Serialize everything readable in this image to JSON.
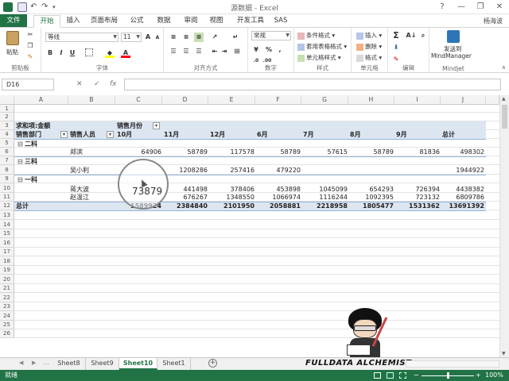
{
  "window": {
    "title": "源数据 - Excel",
    "user": "杨海波",
    "help": "?",
    "minimize": "—",
    "restore": "❐",
    "close": "✕"
  },
  "tabs": [
    "文件",
    "开始",
    "插入",
    "页面布局",
    "公式",
    "数据",
    "审阅",
    "视图",
    "开发工具",
    "SAS"
  ],
  "ribbon": {
    "clipboard": {
      "label": "剪贴板",
      "paste": "粘贴"
    },
    "font": {
      "label": "字体",
      "name": "等线",
      "size": "11",
      "bold": "B",
      "italic": "I",
      "underline": "U",
      "grow": "A",
      "shrink": "A",
      "color": "A"
    },
    "alignment": {
      "label": "对齐方式"
    },
    "number": {
      "label": "数字",
      "format": "常规",
      "percent": "%",
      "comma": ","
    },
    "styles": {
      "label": "样式",
      "conditional": "条件格式",
      "table": "套用表格格式",
      "cell": "单元格样式"
    },
    "cells": {
      "label": "单元格",
      "insert": "插入",
      "delete": "删除",
      "format": "格式"
    },
    "editing": {
      "label": "编辑",
      "sum": "Σ"
    },
    "mindjet": {
      "label": "Mindjet",
      "send": "发送到",
      "app": "MindManager"
    }
  },
  "formula_bar": {
    "name_box": "D16",
    "cancel": "✕",
    "confirm": "✓",
    "fx": "fx",
    "value": ""
  },
  "columns": [
    "A",
    "B",
    "C",
    "D",
    "E",
    "F",
    "G",
    "H",
    "I",
    "J"
  ],
  "rows": [
    "1",
    "2",
    "3",
    "4",
    "5",
    "6",
    "7",
    "8",
    "9",
    "10",
    "11",
    "12",
    "13",
    "14",
    "15",
    "16",
    "17",
    "18",
    "19",
    "20",
    "21",
    "22",
    "23",
    "24",
    "25",
    "26"
  ],
  "pivot": {
    "value_label": "求和项:金额",
    "col_field": "销售月份",
    "row_field_1": "销售部门",
    "row_field_2": "销售人员",
    "months": [
      "10月",
      "11月",
      "12月",
      "6月",
      "7月",
      "8月",
      "9月",
      "总计"
    ],
    "groups": [
      {
        "name": "二科",
        "toggle": "⊟",
        "people": [
          {
            "name": "郑滨",
            "values": [
              "64906",
              "58789",
              "117578",
              "58789",
              "57615",
              "58789",
              "81836",
              "498302"
            ]
          }
        ]
      },
      {
        "name": "三科",
        "toggle": "⊟",
        "people": [
          {
            "name": "吴小利",
            "values": [
              "",
              "1208286",
              "257416",
              "479220",
              "",
              "",
              "",
              "1944922"
            ]
          }
        ]
      },
      {
        "name": "一科",
        "toggle": "⊟",
        "people": [
          {
            "name": "蒋大波",
            "values": [
              "",
              "441498",
              "378406",
              "453898",
              "1045099",
              "654293",
              "726394",
              "4438382"
            ]
          },
          {
            "name": "赵温江",
            "values": [
              "",
              "676267",
              "1348550",
              "1066974",
              "1116244",
              "1092395",
              "723132",
              "6809786"
            ]
          }
        ]
      }
    ],
    "total_label": "总计",
    "totals": [
      "1589924",
      "2384840",
      "2101950",
      "2058881",
      "2218958",
      "1805477",
      "1531362",
      "13691392"
    ]
  },
  "tooltip_value": "73879",
  "sheets": [
    "Sheet8",
    "Sheet9",
    "Sheet10",
    "Sheet1"
  ],
  "active_sheet": "Sheet10",
  "brand_text": "FULLDATA ALCHEMIST",
  "status": {
    "ready": "就绪",
    "zoom": "100%",
    "zoom_minus": "−",
    "zoom_plus": "+"
  },
  "colors": {
    "excel_green": "#217346",
    "pivot_header": "#dce6f1",
    "pivot_line": "#95b3d7"
  }
}
